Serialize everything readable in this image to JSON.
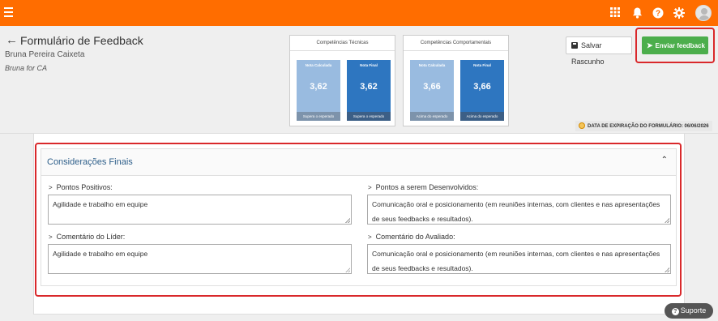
{
  "topbar": {
    "icons": [
      "menu-icon",
      "apps-grid-icon",
      "bell-icon",
      "help-icon",
      "gear-icon",
      "avatar"
    ],
    "color": "#ff6d00"
  },
  "header": {
    "title": "Formulário de Feedback",
    "employee_name": "Bruna Pereira Caixeta",
    "company": "Bruna for CA"
  },
  "competencias": [
    {
      "title": "Competências Técnicas",
      "cards": [
        {
          "label": "Nota Calculada",
          "value": "3,62",
          "footer": "Supera o esperado",
          "style": "light"
        },
        {
          "label": "Nota Final",
          "value": "3,62",
          "footer": "Supera o esperado",
          "style": "dark"
        }
      ]
    },
    {
      "title": "Competências Comportamentais",
      "cards": [
        {
          "label": "Nota Calculada",
          "value": "3,66",
          "footer": "Acima do esperado",
          "style": "light"
        },
        {
          "label": "Nota Final",
          "value": "3,66",
          "footer": "Acima do esperado",
          "style": "dark"
        }
      ]
    }
  ],
  "actions": {
    "save_draft": "Salvar Rascunho",
    "send_feedback": "Enviar feedback"
  },
  "expiry": "DATA DE EXPIRAÇÃO DO FORMULÁRIO: 06/06/2026",
  "final": {
    "title": "Considerações Finais",
    "pontos_positivos_label": "Pontos Positivos:",
    "pontos_positivos_value": "Agilidade e trabalho em equipe",
    "pontos_desenvolver_label": "Pontos a serem Desenvolvidos:",
    "pontos_desenvolver_value": "Comunicação oral e posicionamento (em reuniões internas, com clientes e nas apresentações de seus feedbacks e resultados).",
    "comentario_lider_label": "Comentário do Líder:",
    "comentario_lider_value": "Agilidade e trabalho em equipe",
    "comentario_avaliado_label": "Comentário do Avaliado:",
    "comentario_avaliado_value": "Comunicação oral e posicionamento (em reuniões internas, com clientes e nas apresentações de seus feedbacks e resultados)."
  },
  "support": "Suporte"
}
